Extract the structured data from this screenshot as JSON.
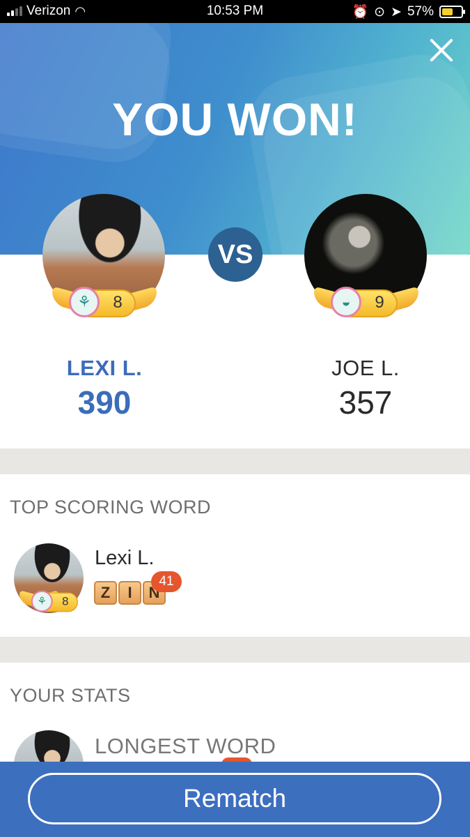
{
  "status_bar": {
    "carrier": "Verizon",
    "time": "10:53 PM",
    "battery": "57%"
  },
  "header": {
    "title": "YOU WON!"
  },
  "versus_label": "VS",
  "players": [
    {
      "name": "LEXI L.",
      "score": "390",
      "level": "8",
      "highlight_color": "#3c6cba"
    },
    {
      "name": "JOE L.",
      "score": "357",
      "level": "9",
      "highlight_color": "#2a2a2a"
    }
  ],
  "top_scoring_word": {
    "section_title": "TOP SCORING WORD",
    "player_name": "Lexi L.",
    "level": "8",
    "tiles": [
      "Z",
      "I",
      "N"
    ],
    "points": "41"
  },
  "your_stats": {
    "section_title": "YOUR STATS",
    "stat_label": "LONGEST WORD"
  },
  "actions": {
    "rematch_label": "Rematch"
  }
}
